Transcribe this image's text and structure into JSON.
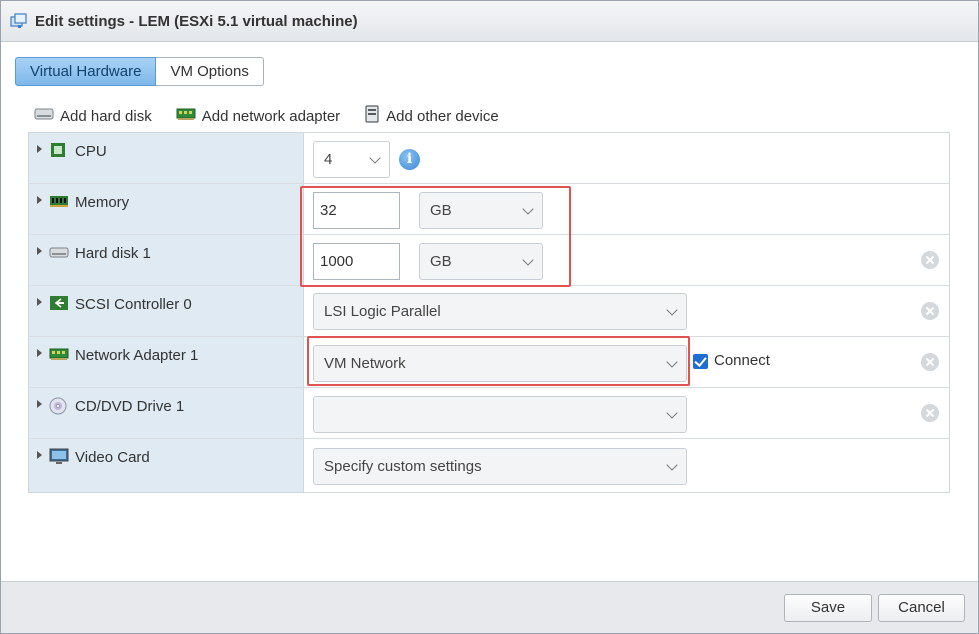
{
  "window": {
    "title": "Edit settings - LEM (ESXi 5.1 virtual machine)"
  },
  "tabs": [
    {
      "label": "Virtual Hardware",
      "active": true
    },
    {
      "label": "VM Options",
      "active": false
    }
  ],
  "add_actions": [
    {
      "label": "Add hard disk",
      "icon": "hard-disk-icon"
    },
    {
      "label": "Add network adapter",
      "icon": "network-card-icon"
    },
    {
      "label": "Add other device",
      "icon": "device-icon"
    }
  ],
  "hardware": {
    "cpu": {
      "label": "CPU",
      "value": "4"
    },
    "memory": {
      "label": "Memory",
      "value": "32",
      "unit": "GB"
    },
    "hard_disk": {
      "label": "Hard disk 1",
      "value": "1000",
      "unit": "GB"
    },
    "scsi": {
      "label": "SCSI Controller 0",
      "value": "LSI Logic Parallel"
    },
    "network": {
      "label": "Network Adapter 1",
      "value": "VM Network",
      "connect_label": "Connect",
      "connected": true
    },
    "cdrom": {
      "label": "CD/DVD Drive 1",
      "value": ""
    },
    "video": {
      "label": "Video Card",
      "value": "Specify custom settings"
    }
  },
  "footer": {
    "save_label": "Save",
    "cancel_label": "Cancel"
  },
  "colors": {
    "accent": "#7db8ea",
    "highlight": "#e15252",
    "label_bg": "#dfeaf3"
  }
}
